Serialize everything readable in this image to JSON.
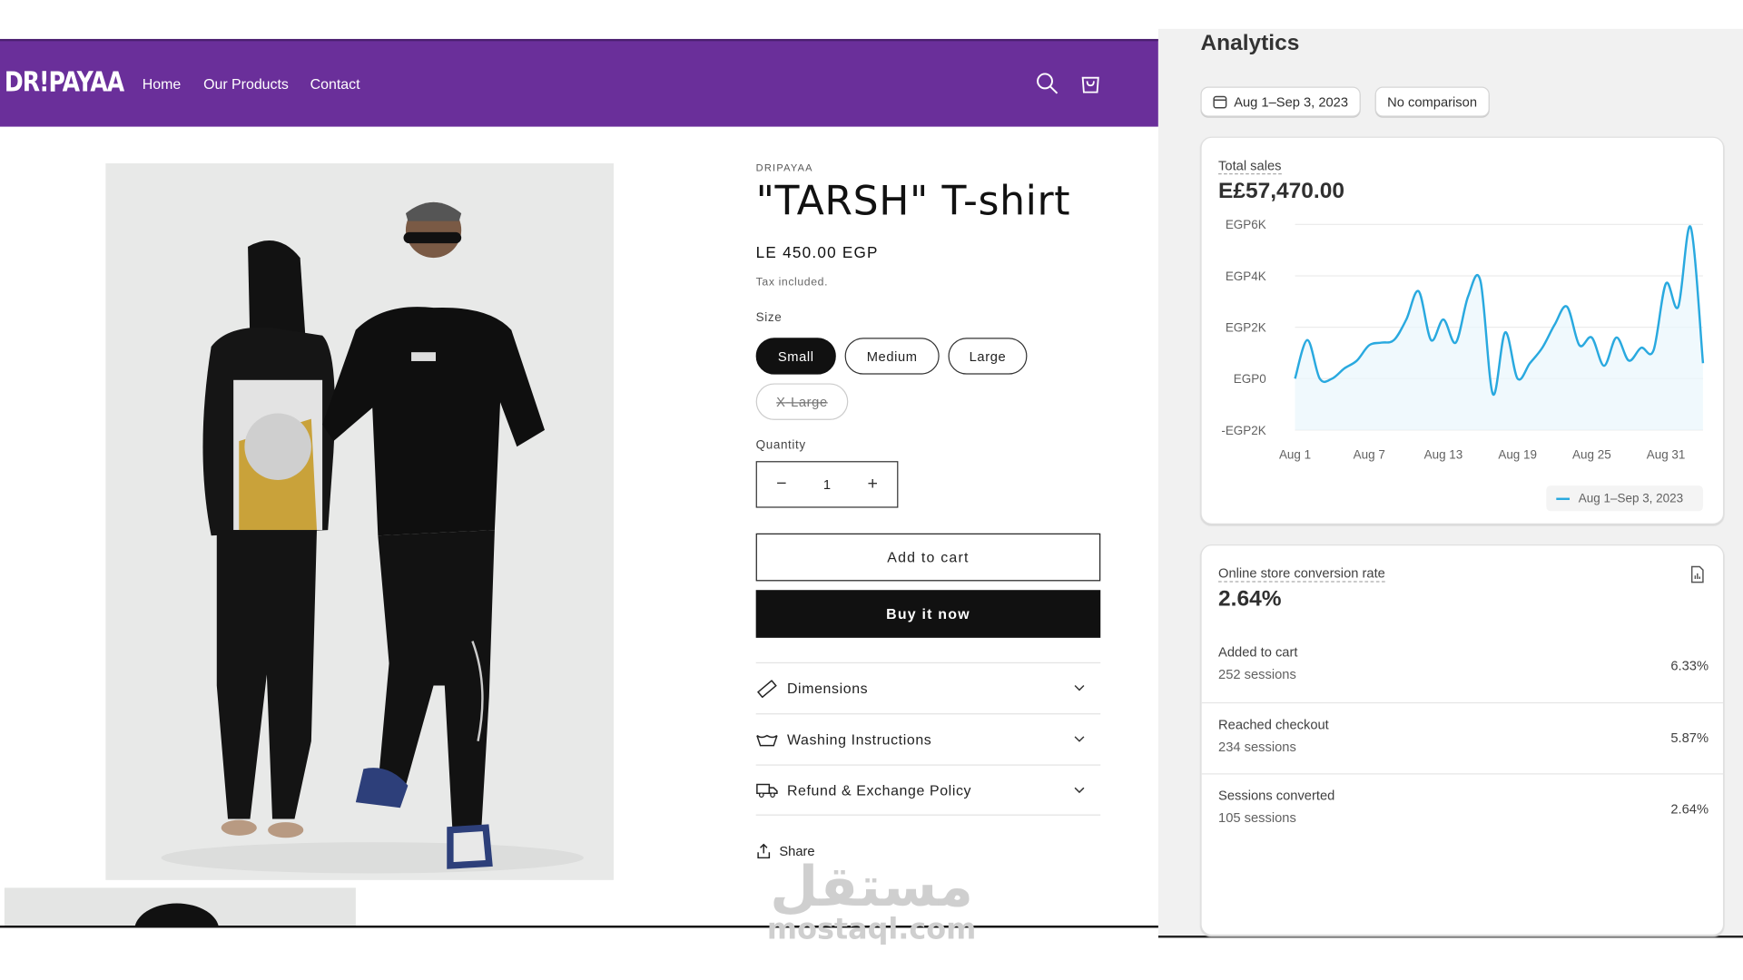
{
  "store": {
    "brand": "DR!PAYAA",
    "nav": [
      "Home",
      "Our Products",
      "Contact"
    ],
    "product": {
      "vendor": "DRIPAYAA",
      "title": "\"TARSH\" T-shirt",
      "price": "LE 450.00 EGP",
      "tax_note": "Tax included.",
      "size_label": "Size",
      "sizes": [
        "Small",
        "Medium",
        "Large",
        "X-Large"
      ],
      "selected_size": "Small",
      "unavailable_size": "X-Large",
      "quantity_label": "Quantity",
      "quantity": "1",
      "minus": "−",
      "plus": "+",
      "add_to_cart": "Add to cart",
      "buy_now": "Buy it now",
      "accordions": [
        "Dimensions",
        "Washing Instructions",
        "Refund & Exchange Policy"
      ],
      "share": "Share"
    },
    "watermark": {
      "arabic": "مستقل",
      "latin": "mostaql.com"
    }
  },
  "analytics": {
    "title": "Analytics",
    "date_range": "Aug 1–Sep 3, 2023",
    "comparison": "No comparison",
    "total_sales": {
      "label": "Total sales",
      "value": "E£57,470.00",
      "legend": "Aug 1–Sep 3, 2023"
    },
    "conversion": {
      "label": "Online store conversion rate",
      "value": "2.64%",
      "rows": [
        {
          "label": "Added to cart",
          "sessions": "252 sessions",
          "pct": "6.33%"
        },
        {
          "label": "Reached checkout",
          "sessions": "234 sessions",
          "pct": "5.87%"
        },
        {
          "label": "Sessions converted",
          "sessions": "105 sessions",
          "pct": "2.64%"
        }
      ]
    }
  },
  "chart_data": {
    "type": "line",
    "title": "",
    "xlabel": "",
    "ylabel": "",
    "y_tick_labels": [
      "EGP6K",
      "EGP4K",
      "EGP2K",
      "EGP0",
      "-EGP2K"
    ],
    "y_ticks": [
      6000,
      4000,
      2000,
      0,
      -2000
    ],
    "ylim": [
      -2000,
      6000
    ],
    "x_tick_labels": [
      "Aug 1",
      "Aug 7",
      "Aug 13",
      "Aug 19",
      "Aug 25",
      "Aug 31"
    ],
    "x_tick_days": [
      1,
      7,
      13,
      19,
      25,
      31
    ],
    "xlim": [
      1,
      34
    ],
    "grid": true,
    "color": "#29a9df",
    "series": [
      {
        "name": "Aug 1–Sep 3, 2023",
        "x": [
          1,
          2,
          3,
          4,
          5,
          6,
          7,
          8,
          9,
          10,
          11,
          12,
          13,
          14,
          15,
          16,
          17,
          18,
          19,
          20,
          21,
          22,
          23,
          24,
          25,
          26,
          27,
          28,
          29,
          30,
          31,
          32,
          33,
          34
        ],
        "y": [
          0,
          1500,
          0,
          0,
          400,
          700,
          1300,
          1400,
          1500,
          2300,
          3400,
          1500,
          2300,
          1400,
          3200,
          3800,
          -600,
          1800,
          0,
          600,
          1200,
          2100,
          2800,
          1300,
          1600,
          500,
          1600,
          700,
          1200,
          1100,
          3700,
          2800,
          5900,
          600
        ]
      }
    ]
  }
}
